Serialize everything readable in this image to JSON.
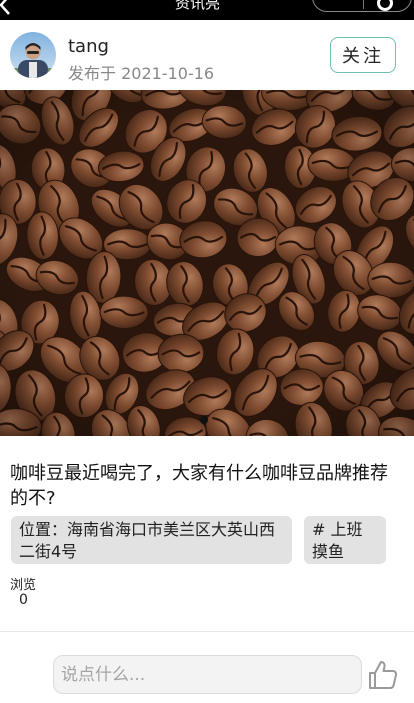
{
  "topbar": {
    "title": "资讯亮"
  },
  "author": {
    "name": "tang",
    "published": "发布于 2021-10-16",
    "follow_label": "关注"
  },
  "post": {
    "text": "咖啡豆最近喝完了，大家有什么咖啡豆品牌推荐的不?",
    "location_tag": "位置：海南省海口市美兰区大英山西二街4号",
    "topic_tag": "# 上班摸鱼",
    "views_label": "浏览",
    "views_count": "0"
  },
  "carousel": {
    "current_index": 1,
    "total": 1
  },
  "comment": {
    "placeholder": "说点什么..."
  },
  "colors": {
    "follow_border": "#6cc0b4",
    "tag_bg": "#e2e2e2",
    "topbar_bg": "#000000"
  }
}
